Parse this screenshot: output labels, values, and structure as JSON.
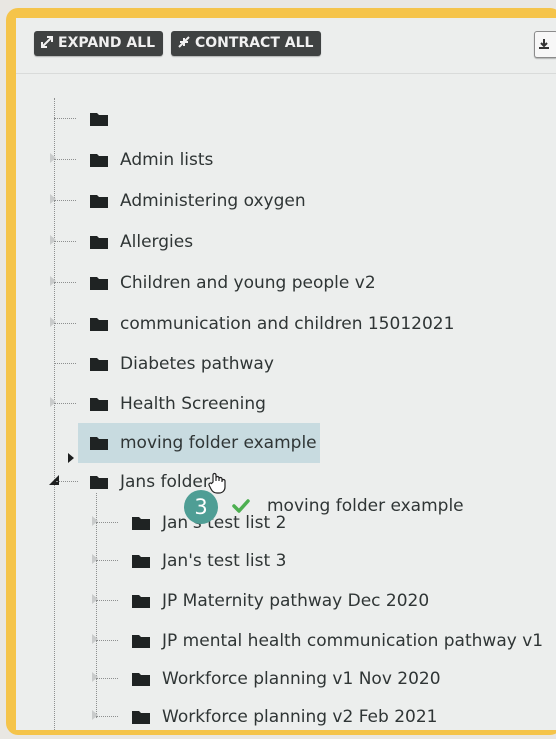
{
  "toolbar": {
    "expand_all": "EXPAND ALL",
    "contract_all": "CONTRACT ALL",
    "download_icon": "download-icon"
  },
  "tree": {
    "root_items": [
      {
        "label": ""
      },
      {
        "label": "Admin lists"
      },
      {
        "label": "Administering oxygen"
      },
      {
        "label": "Allergies"
      },
      {
        "label": "Children and young people v2"
      },
      {
        "label": "communication and children 15012021"
      },
      {
        "label": "Diabetes pathway"
      },
      {
        "label": "Health Screening"
      },
      {
        "label": "moving folder example",
        "highlighted": true
      },
      {
        "label": "Jans folder",
        "expanded": true
      }
    ],
    "child_items": [
      {
        "label": "Jan's test list 2"
      },
      {
        "label": "Jan's test list 3"
      },
      {
        "label": "JP Maternity pathway Dec 2020"
      },
      {
        "label": "JP mental health communication pathway v1"
      },
      {
        "label": "Workforce planning v1 Nov 2020"
      },
      {
        "label": "Workforce planning v2 Feb 2021"
      }
    ]
  },
  "drag": {
    "step_number": "3",
    "label": "moving folder example",
    "status_icon": "check-icon"
  },
  "colors": {
    "frame": "#f5c44a",
    "highlight": "#c8dbe0",
    "badge": "#4f9e95",
    "check": "#4caf50",
    "button": "#3f4242"
  }
}
